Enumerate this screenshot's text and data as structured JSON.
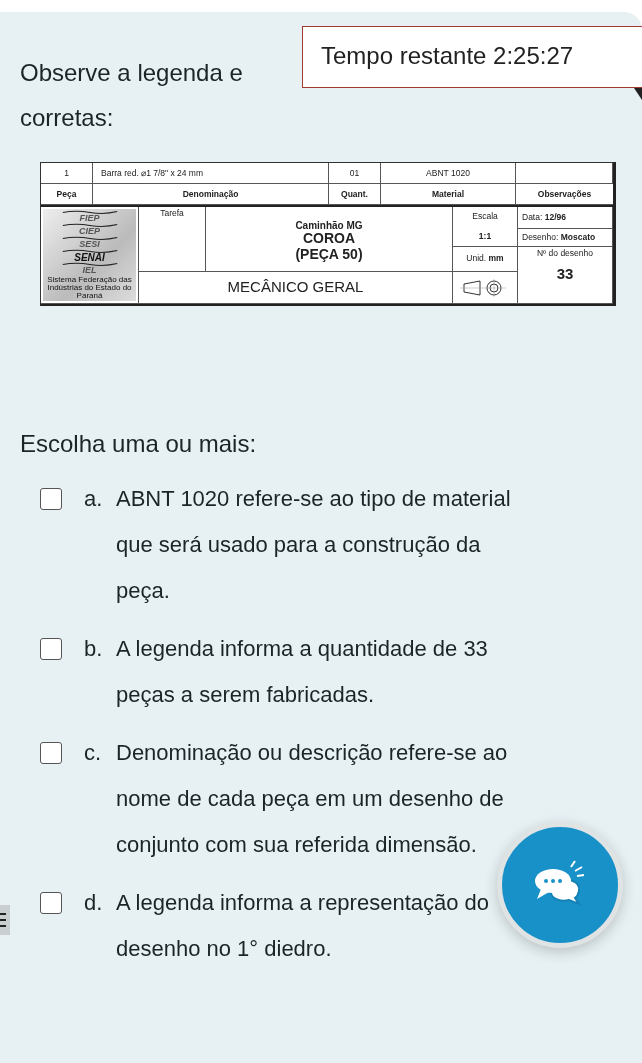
{
  "timer": {
    "label": "Tempo restante 2:25:27"
  },
  "question": {
    "lines": [
      "Observe a legenda e",
      "corretas:"
    ]
  },
  "title_block": {
    "part_row": [
      "1",
      "Barra red. ⌀1  7/8\" x 24 mm",
      "01",
      "ABNT 1020"
    ],
    "header_row": [
      "Peça",
      "Denominação",
      "Quant.",
      "Material",
      "Observações"
    ],
    "logo": {
      "words": [
        "FIEP",
        "CIEP",
        "SESI",
        "SENAI",
        "IEL"
      ],
      "caption": "Sistema Federação das Indústrias do Estado do Paraná"
    },
    "task_label": "Tarefa",
    "title_lines": [
      "Caminhão MG",
      "COROA",
      "(PEÇA 50)"
    ],
    "course": "MECÂNICO GERAL",
    "scale_label": "Escala",
    "scale": "1:1",
    "unit_label": "Unid.",
    "unit": "mm",
    "date_label": "Data:",
    "date": "12/96",
    "drawn_label": "Desenho:",
    "drawn_by": "Moscato",
    "drawing_no_label": "Nº do desenho",
    "drawing_no": "33"
  },
  "instruction": "Escolha uma ou mais:",
  "options": [
    {
      "letter": "a.",
      "text": "ABNT 1020 refere-se ao tipo de material que será usado para a construção da peça.",
      "checked": false
    },
    {
      "letter": "b.",
      "text": "A legenda informa a quantidade de 33 peças a serem fabricadas.",
      "checked": false
    },
    {
      "letter": "c.",
      "text": "Denominação ou descrição refere-se ao nome de cada peça em um desenho de conjunto com sua referida dimensão.",
      "checked": false
    },
    {
      "letter": "d.",
      "text": "A legenda informa a representação do desenho no 1° diedro.",
      "checked": false
    }
  ]
}
